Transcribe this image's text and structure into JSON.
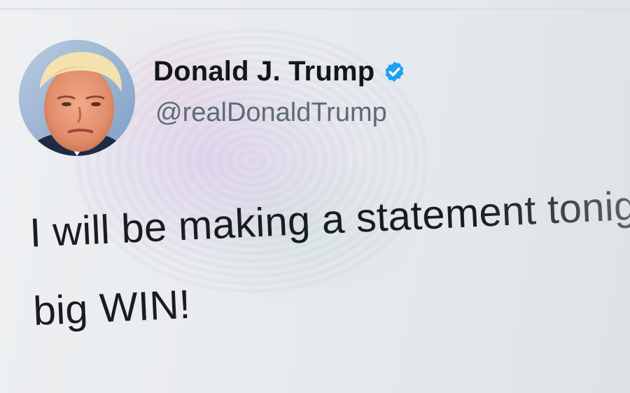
{
  "profile": {
    "display_name": "Donald J. Trump",
    "handle": "@realDonaldTrump",
    "verified": true,
    "verified_color": "#1da1f2"
  },
  "tweet": {
    "lines": [
      "I will be making a statement tonight.",
      "big WIN!"
    ]
  },
  "icons": {
    "avatar": "profile-photo",
    "badge": "verified-badge-icon"
  }
}
